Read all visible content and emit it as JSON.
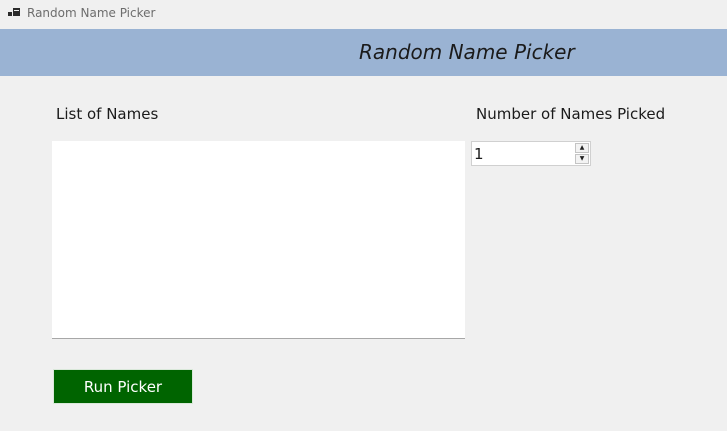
{
  "window": {
    "title": "Random Name Picker",
    "icon": "app-window-icon"
  },
  "header": {
    "title": "Random Name Picker",
    "background_color": "#9ab3d3"
  },
  "names_list": {
    "label": "List of Names",
    "value": ""
  },
  "names_picked": {
    "label": "Number of Names Picked",
    "value": "1"
  },
  "actions": {
    "run_label": "Run Picker",
    "run_color": "#006400"
  }
}
